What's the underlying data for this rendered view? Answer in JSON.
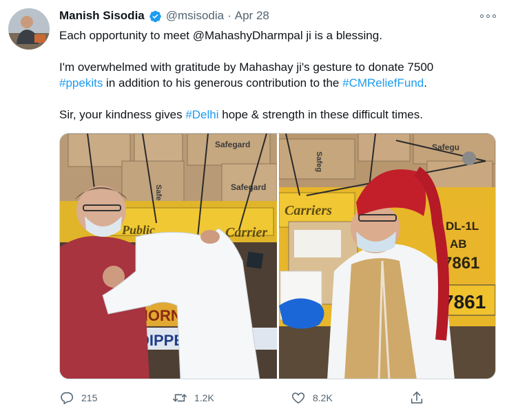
{
  "tweet": {
    "author_name": "Manish Sisodia",
    "handle": "@msisodia",
    "separator": "·",
    "date": "Apr 28",
    "line1": "Each opportunity to meet @MahashyDharmpal ji is a blessing.",
    "p2_a": "I'm overwhelmed with gratitude by Mahashay ji's gesture to donate 7500",
    "p2_tag1": "#ppekits",
    "p2_b": " in addition to his generous contribution to the ",
    "p2_tag2": "#CMReliefFund",
    "p2_c": ".",
    "p3_a": "Sir, your kindness gives ",
    "p3_tag": "#Delhi",
    "p3_b": " hope & strength in these difficult times."
  },
  "media": {
    "left_signs": [
      "Safegard",
      "Safegard",
      "Safegard",
      "Carrier",
      "Public",
      "DIPPER",
      "HORN"
    ],
    "right_signs": [
      "Safeg",
      "Safegu",
      "Carriers",
      "DL-1L",
      "AB",
      "7861",
      "7861"
    ]
  },
  "actions": {
    "reply_count": "215",
    "retweet_count": "1.2K",
    "like_count": "8.2K"
  },
  "colors": {
    "link": "#1d9bf0",
    "muted": "#536471",
    "text": "#0f1419"
  }
}
